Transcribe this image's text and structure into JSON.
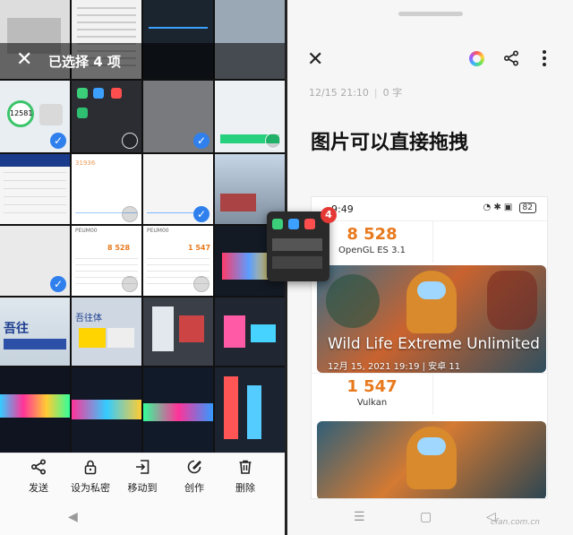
{
  "gallery": {
    "selection_title": "已选择 4 项",
    "thumb_texts": {
      "benchmark_score": "31936",
      "device_a": "PEUM00",
      "device_b": "PEUM00",
      "opengl_partial": "OpenGL ES 3.1",
      "score_a": "8 528",
      "score_b": "1 547",
      "storage_score": "12581"
    },
    "actions": [
      {
        "label": "发送",
        "icon": "share-icon"
      },
      {
        "label": "设为私密",
        "icon": "lock-icon"
      },
      {
        "label": "移动到",
        "icon": "move-to-icon"
      },
      {
        "label": "创作",
        "icon": "edit-icon"
      },
      {
        "label": "删除",
        "icon": "trash-icon"
      }
    ]
  },
  "drag": {
    "count_badge": "4"
  },
  "note": {
    "date": "12/15 21:10",
    "char_count": "0 字",
    "title": "图片可以直接拖拽",
    "embedded": {
      "status_time": "9:49",
      "battery": "82",
      "scores": [
        {
          "value": "8 528",
          "label": "OpenGL ES 3.1"
        },
        {
          "value": "1 547",
          "label": "Vulkan"
        }
      ],
      "banner_title": "Wild Life Extreme Unlimited",
      "banner_date": "12月 15, 2021 19:19 | 安卓 11"
    }
  },
  "watermark": "cfan.com.cn",
  "colors": {
    "accent": "#2f80ed",
    "score": "#e87a1e",
    "badge": "#e53935"
  }
}
